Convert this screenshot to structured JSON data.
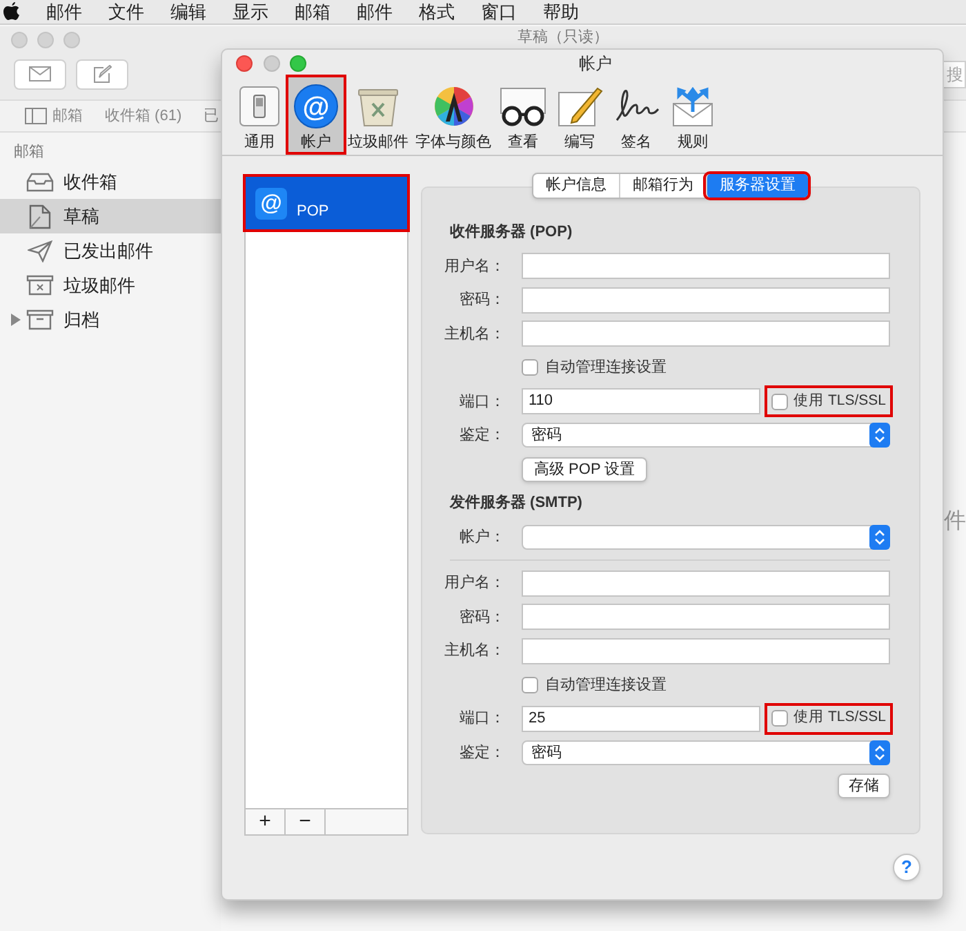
{
  "menu_bar": {
    "items": [
      "邮件",
      "文件",
      "编辑",
      "显示",
      "邮箱",
      "邮件",
      "格式",
      "窗口",
      "帮助"
    ]
  },
  "mail_window": {
    "title": "草稿（只读）",
    "search": {
      "placeholder": "搜"
    },
    "tabs": [
      {
        "label": "邮箱"
      },
      {
        "label": "收件箱 (61)"
      },
      {
        "label": "已"
      }
    ],
    "sidebar": {
      "heading": "邮箱",
      "items": [
        {
          "label": "收件箱",
          "selected": false,
          "expandable": false
        },
        {
          "label": "草稿",
          "selected": true,
          "expandable": false
        },
        {
          "label": "已发出邮件",
          "selected": false,
          "expandable": false
        },
        {
          "label": "垃圾邮件",
          "selected": false,
          "expandable": false
        },
        {
          "label": "归档",
          "selected": false,
          "expandable": true
        }
      ]
    },
    "content_fragment": "件"
  },
  "dialog": {
    "title": "帐户",
    "toolbar": [
      {
        "label": "通用",
        "selected": false,
        "highlighted": false
      },
      {
        "label": "帐户",
        "selected": true,
        "highlighted": true,
        "glyph": "@"
      },
      {
        "label": "垃圾邮件",
        "selected": false,
        "highlighted": false
      },
      {
        "label": "字体与颜色",
        "selected": false,
        "highlighted": false
      },
      {
        "label": "查看",
        "selected": false,
        "highlighted": false
      },
      {
        "label": "编写",
        "selected": false,
        "highlighted": false
      },
      {
        "label": "签名",
        "selected": false,
        "highlighted": false
      },
      {
        "label": "规则",
        "selected": false,
        "highlighted": false
      }
    ],
    "accounts": [
      {
        "label": "POP",
        "glyph": "@",
        "selected": true,
        "highlighted": true
      }
    ],
    "list_buttons": [
      "+",
      "−"
    ],
    "segments": [
      {
        "label": "帐户信息",
        "selected": false,
        "highlighted": false
      },
      {
        "label": "邮箱行为",
        "selected": false,
        "highlighted": false
      },
      {
        "label": "服务器设置",
        "selected": true,
        "highlighted": true
      }
    ],
    "rows": [
      {
        "kind": "heading",
        "text": "收件服务器 (POP)"
      },
      {
        "kind": "text",
        "label": "用户名："
      },
      {
        "kind": "text",
        "label": "密码："
      },
      {
        "kind": "text",
        "label": "主机名："
      },
      {
        "kind": "checkbox",
        "label": "自动管理连接设置",
        "checked": false
      },
      {
        "kind": "port",
        "label": "端口：",
        "value": "110",
        "tls": {
          "label": "使用 TLS/SSL",
          "checked": false,
          "highlighted": true
        }
      },
      {
        "kind": "popup",
        "label": "鉴定：",
        "value": "密码"
      },
      {
        "kind": "button",
        "text": "高级 POP 设置"
      },
      {
        "kind": "heading",
        "text": "发件服务器 (SMTP)"
      },
      {
        "kind": "popup",
        "label": "帐户："
      },
      {
        "kind": "divider"
      },
      {
        "kind": "text",
        "label": "用户名："
      },
      {
        "kind": "text",
        "label": "密码："
      },
      {
        "kind": "text",
        "label": "主机名："
      },
      {
        "kind": "checkbox",
        "label": "自动管理连接设置",
        "checked": false
      },
      {
        "kind": "port",
        "label": "端口：",
        "value": "25",
        "tls": {
          "label": "使用 TLS/SSL",
          "checked": false,
          "highlighted": true
        }
      },
      {
        "kind": "popup",
        "label": "鉴定：",
        "value": "密码"
      },
      {
        "kind": "save",
        "text": "存储"
      }
    ],
    "help": "?"
  }
}
